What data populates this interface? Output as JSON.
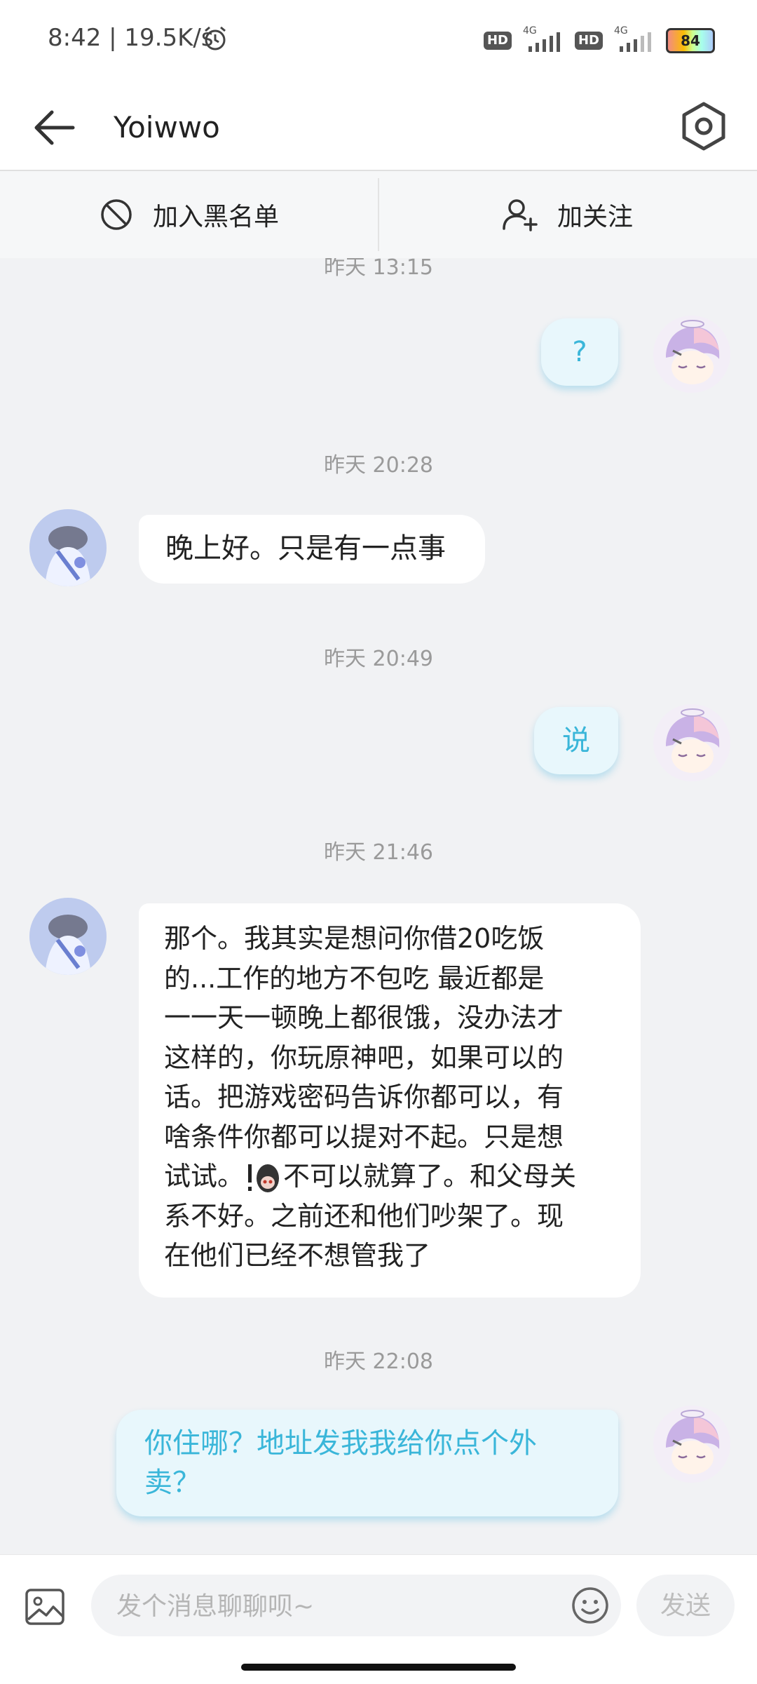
{
  "status_bar": {
    "time": "8:42 | 19.5K/s",
    "hd_label": "HD",
    "net_label": "4G",
    "battery": "84"
  },
  "header": {
    "title": "Yoiwwo"
  },
  "actions": {
    "blacklist": "加入黑名单",
    "follow": "加关注"
  },
  "messages": [
    {
      "time": "昨天 13:15"
    },
    {
      "from": "me",
      "text": "?"
    },
    {
      "time": "昨天 20:28"
    },
    {
      "from": "other",
      "text": "晚上好。只是有一点事"
    },
    {
      "time": "昨天 20:49"
    },
    {
      "from": "me",
      "text": "说"
    },
    {
      "time": "昨天 21:46"
    },
    {
      "from": "other",
      "lines": [
        "那个。我其实是想问你借20吃饭",
        "的...工作的地方不包吃 最近都是",
        "一一天一顿晚上都很饿，没办法才",
        "这样的，你玩原神吧，如果可以的",
        "话。把游戏密码告诉你都可以，有",
        "啥条件你都可以提对不起。只是想",
        "试试。",
        "不可以就算了。和父母关",
        "系不好。之前还和他们吵架了。现",
        "在他们已经不想管我了"
      ]
    },
    {
      "time": "昨天 22:08"
    },
    {
      "from": "me",
      "lines": [
        "你住哪？地址发我我给你点个外",
        "卖？"
      ]
    }
  ],
  "input": {
    "placeholder": "发个消息聊聊呗~",
    "send_label": "发送"
  }
}
